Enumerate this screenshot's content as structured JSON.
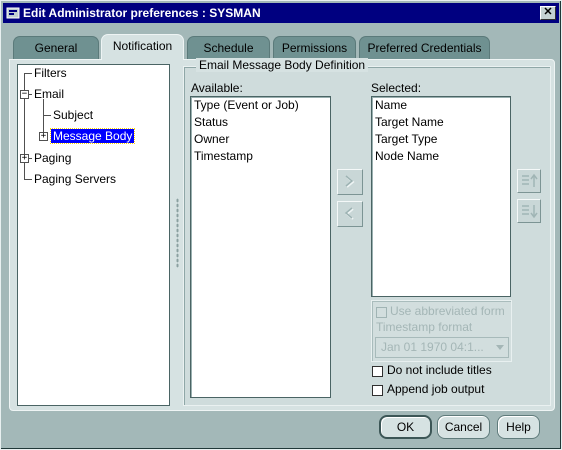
{
  "window": {
    "title": "Edit Administrator preferences : SYSMAN",
    "close_glyph": "✕"
  },
  "tabs": [
    {
      "label": "General",
      "active": false
    },
    {
      "label": "Notification",
      "active": true
    },
    {
      "label": "Schedule",
      "active": false
    },
    {
      "label": "Permissions",
      "active": false
    },
    {
      "label": "Preferred Credentials",
      "active": false
    }
  ],
  "tree": {
    "nodes": [
      {
        "label": "Filters"
      },
      {
        "label": "Email",
        "expanded": true
      },
      {
        "label": "Subject"
      },
      {
        "label": "Message Body",
        "selected": true
      },
      {
        "label": "Paging",
        "expanded": false
      },
      {
        "label": "Paging Servers"
      }
    ],
    "expander_collapsed": "+",
    "expander_expanded": "−"
  },
  "email_body": {
    "group_title": "Email Message Body Definition",
    "available_label": "Available:",
    "available_items": [
      "Type (Event or Job)",
      "Status",
      "Owner",
      "Timestamp"
    ],
    "selected_label": "Selected:",
    "selected_items": [
      "Name",
      "Target Name",
      "Target Type",
      "Node Name"
    ],
    "move_right_glyph": ">",
    "move_left_glyph": "<",
    "use_abbreviated_label": "Use abbreviated form",
    "timestamp_format_label": "Timestamp format",
    "timestamp_format_value": "Jan 01 1970  04:1...",
    "do_not_include_titles_label": "Do not include titles",
    "append_job_output_label": "Append job output"
  },
  "buttons": {
    "ok": "OK",
    "cancel": "Cancel",
    "help": "Help"
  },
  "colors": {
    "title_bar": "#000080",
    "selection": "#0000ff",
    "window_bg": "#a3b8b8",
    "panel_bg": "#d6e2e2"
  }
}
